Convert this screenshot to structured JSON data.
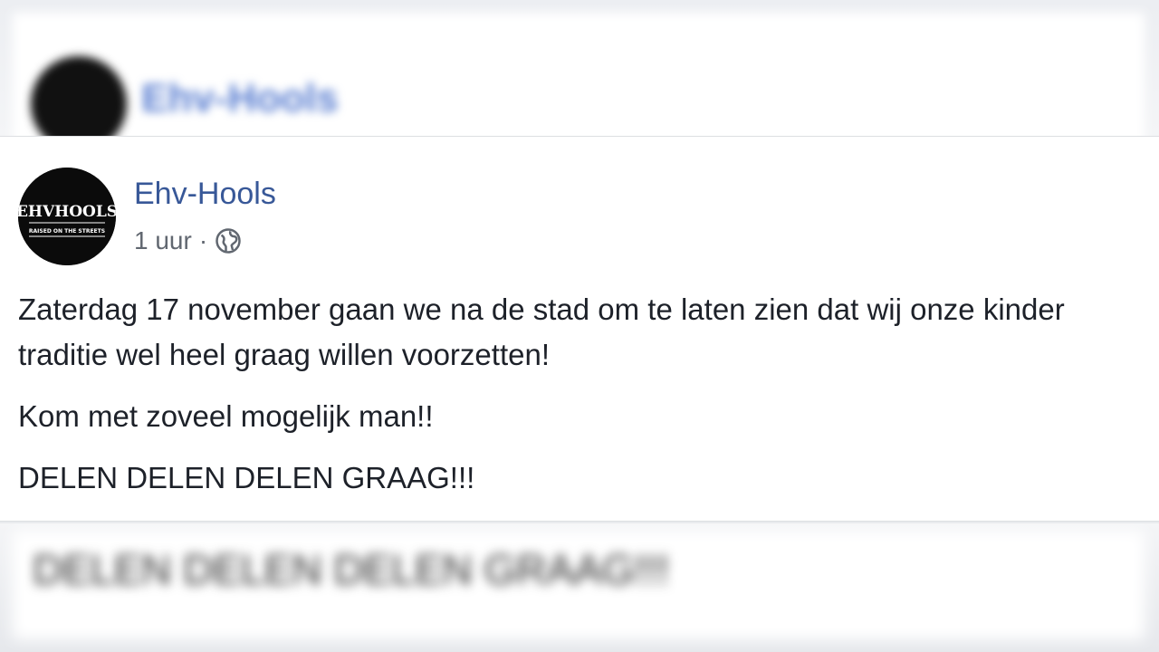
{
  "post": {
    "author": "Ehv-Hools",
    "timestamp": "1 uur",
    "separator": "·",
    "privacy_icon": "globe-icon",
    "avatar": {
      "icon": "ehv-hools-logo",
      "logo_text": "EHVHOOLS",
      "logo_subtext": "RAISED ON THE STREETS"
    },
    "paragraphs": [
      "Zaterdag 17 november gaan we na de stad om te laten zien dat wij onze kinder traditie wel heel graag willen voorzetten!",
      "Kom met zoveel mogelijk man!!",
      "DELEN DELEN DELEN GRAAG!!!"
    ]
  },
  "background": {
    "top_name": "Ehv-Hools",
    "bottom_text": "DELEN DELEN DELEN GRAAG!!!"
  },
  "colors": {
    "author_link": "#385898",
    "meta_text": "#616770",
    "body_text": "#1d2129"
  }
}
